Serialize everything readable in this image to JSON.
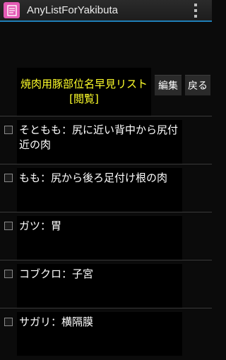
{
  "app": {
    "title": "AnyListForYakibuta",
    "icon_glyph": "卐",
    "accent_color": "#1f7fb8",
    "icon_color": "#e35ab4"
  },
  "header": {
    "list_title": "焼肉用豚部位名早見リスト[閲覧]",
    "edit_label": "編集",
    "back_label": "戻る"
  },
  "items": [
    {
      "text": "そともも：尻に近い背中から尻付近の肉",
      "checked": false
    },
    {
      "text": "もも：尻から後ろ足付け根の肉",
      "checked": false
    },
    {
      "text": "ガツ：胃",
      "checked": false
    },
    {
      "text": "コブクロ：子宮",
      "checked": false
    },
    {
      "text": "サガリ：横隔膜",
      "checked": false
    }
  ]
}
